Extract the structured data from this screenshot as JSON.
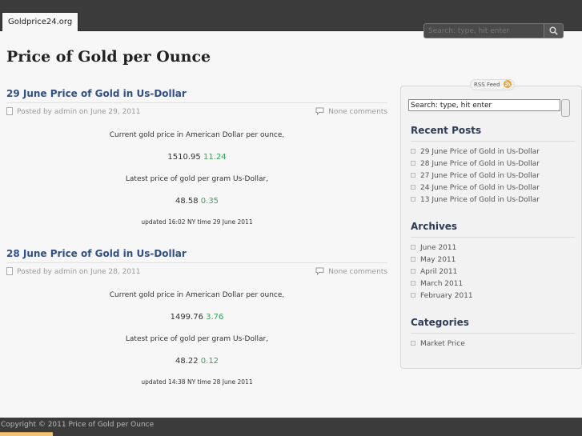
{
  "header": {
    "site_tab": "Goldprice24.org",
    "search_placeholder": "Search: type, hit enter"
  },
  "page": {
    "title": "Price of Gold per Ounce"
  },
  "posts": [
    {
      "title": "29 June Price of Gold in Us-Dollar",
      "meta": "Posted by admin on June 29, 2011",
      "comments": "None comments",
      "line1": "Current gold price in American Dollar per ounce,",
      "price_oz": "1510.95",
      "change_oz": "11.24",
      "line2": "Latest price of gold per gram Us-Dollar,",
      "price_g": "48.58",
      "change_g": "0.35",
      "updated": "updated 16:02 NY time 29 June 2011"
    },
    {
      "title": "28 June Price of Gold in Us-Dollar",
      "meta": "Posted by admin on June 28, 2011",
      "comments": "None comments",
      "line1": "Current gold price in American Dollar per ounce,",
      "price_oz": "1499.76",
      "change_oz": "3.76",
      "line2": "Latest price of gold per gram Us-Dollar,",
      "price_g": "48.22",
      "change_g": "0.12",
      "updated": "updated 14:38 NY time 28 June 2011"
    }
  ],
  "sidebar": {
    "rss_label": "RSS Feed",
    "search_value": "Search: type, hit enter",
    "recent": {
      "title": "Recent Posts",
      "items": [
        "29 June Price of Gold in Us-Dollar",
        "28 June Price of Gold in Us-Dollar",
        "27 June Price of Gold in Us-Dollar",
        "24 June Price of Gold in Us-Dollar",
        "13 June Price of Gold in Us-Dollar"
      ]
    },
    "archives": {
      "title": "Archives",
      "items": [
        "June 2011",
        "May 2011",
        "April 2011",
        "March 2011",
        "February 2011"
      ]
    },
    "categories": {
      "title": "Categories",
      "items": [
        "Market Price"
      ]
    }
  },
  "footer": {
    "text": "Copyright © 2011 Price of Gold per Ounce"
  },
  "colors": {
    "topbar": "#3b3b3b",
    "post_title": "#2f4f8a",
    "positive_change": "#3aa55a"
  },
  "icons": [
    "search-icon",
    "document-icon",
    "comment-icon",
    "rss-icon"
  ]
}
